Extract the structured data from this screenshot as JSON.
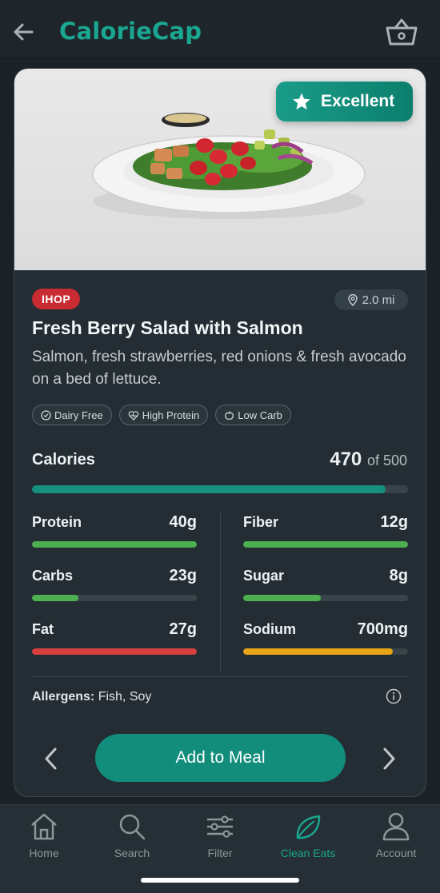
{
  "app": {
    "brand": "CalorieCap"
  },
  "colors": {
    "accent": "#1aa690",
    "brand_tag": "#c82b31",
    "protein": "#4caf50",
    "fat": "#d84040",
    "sodium": "#e8a317"
  },
  "header": {
    "back_icon": "arrow-left-icon",
    "basket_icon": "basket-icon"
  },
  "item": {
    "rating": "Excellent",
    "restaurant": "IHOP",
    "distance": "2.0 mi",
    "title": "Fresh Berry Salad with Salmon",
    "description": "Salmon, fresh strawberries, red onions & fresh avocado on a bed of lettuce.",
    "tags": [
      "Dairy Free",
      "High Protein",
      "Low Carb"
    ]
  },
  "calories": {
    "label": "Calories",
    "value": "470",
    "of_text": "of 500",
    "fraction": 0.94
  },
  "nutrients": {
    "protein": {
      "label": "Protein",
      "value": "40g",
      "fraction": 1.0
    },
    "carbs": {
      "label": "Carbs",
      "value": "23g",
      "fraction": 0.28
    },
    "fat": {
      "label": "Fat",
      "value": "27g",
      "fraction": 1.0
    },
    "fiber": {
      "label": "Fiber",
      "value": "12g",
      "fraction": 1.0
    },
    "sugar": {
      "label": "Sugar",
      "value": "8g",
      "fraction": 0.47
    },
    "sodium": {
      "label": "Sodium",
      "value": "700mg",
      "fraction": 0.91
    }
  },
  "allergens": {
    "label": "Allergens:",
    "value": "Fish, Soy"
  },
  "actions": {
    "add_to_meal": "Add to Meal"
  },
  "nav": [
    {
      "label": "Home",
      "icon": "home-icon"
    },
    {
      "label": "Search",
      "icon": "search-icon"
    },
    {
      "label": "Filter",
      "icon": "sliders-icon"
    },
    {
      "label": "Clean Eats",
      "icon": "leaf-icon"
    },
    {
      "label": "Account",
      "icon": "person-icon"
    }
  ]
}
